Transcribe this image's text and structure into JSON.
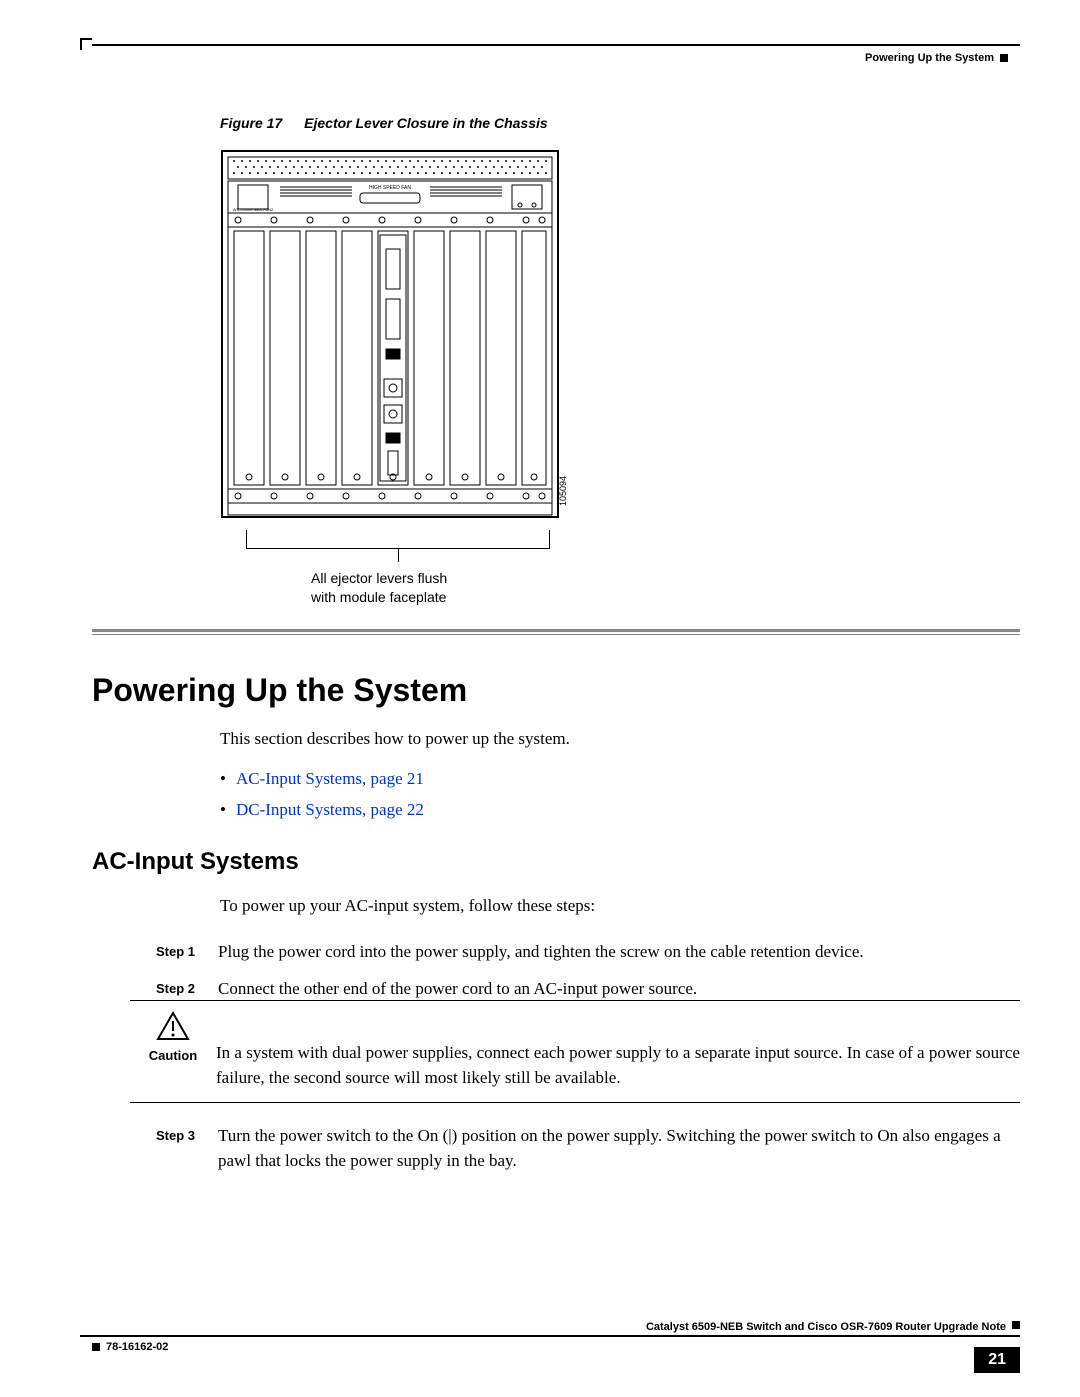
{
  "running_head": "Powering Up the System",
  "figure": {
    "label": "Figure 17",
    "title": "Ejector Lever Closure in the Chassis",
    "callout_line1": "All ejector levers flush",
    "callout_line2": "with module faceplate",
    "diagram_id": "105094",
    "fan_label": "HIGH SPEED FAN"
  },
  "section": {
    "h1": "Powering Up the System",
    "intro": "This section describes how to power up the system.",
    "links": [
      "AC-Input Systems, page 21",
      "DC-Input Systems, page 22"
    ],
    "h2": "AC-Input Systems",
    "h2_intro": "To power up your AC-input system, follow these steps:"
  },
  "steps": {
    "s1_label": "Step 1",
    "s1_text": "Plug the power cord into the power supply, and tighten the screw on the cable retention device.",
    "s2_label": "Step 2",
    "s2_text": "Connect the other end of the power cord to an AC-input power source.",
    "s3_label": "Step 3",
    "s3_text": "Turn the power switch to the On (|) position on the power supply. Switching the power switch to On also engages a pawl that locks the power supply in the bay."
  },
  "caution": {
    "label": "Caution",
    "text": "In a system with dual power supplies, connect each power supply to a separate input source. In case of a power source failure, the second source will most likely still be available."
  },
  "footer": {
    "book": "Catalyst 6509-NEB Switch and Cisco OSR-7609 Router Upgrade Note",
    "docnum": "78-16162-02",
    "page": "21"
  }
}
